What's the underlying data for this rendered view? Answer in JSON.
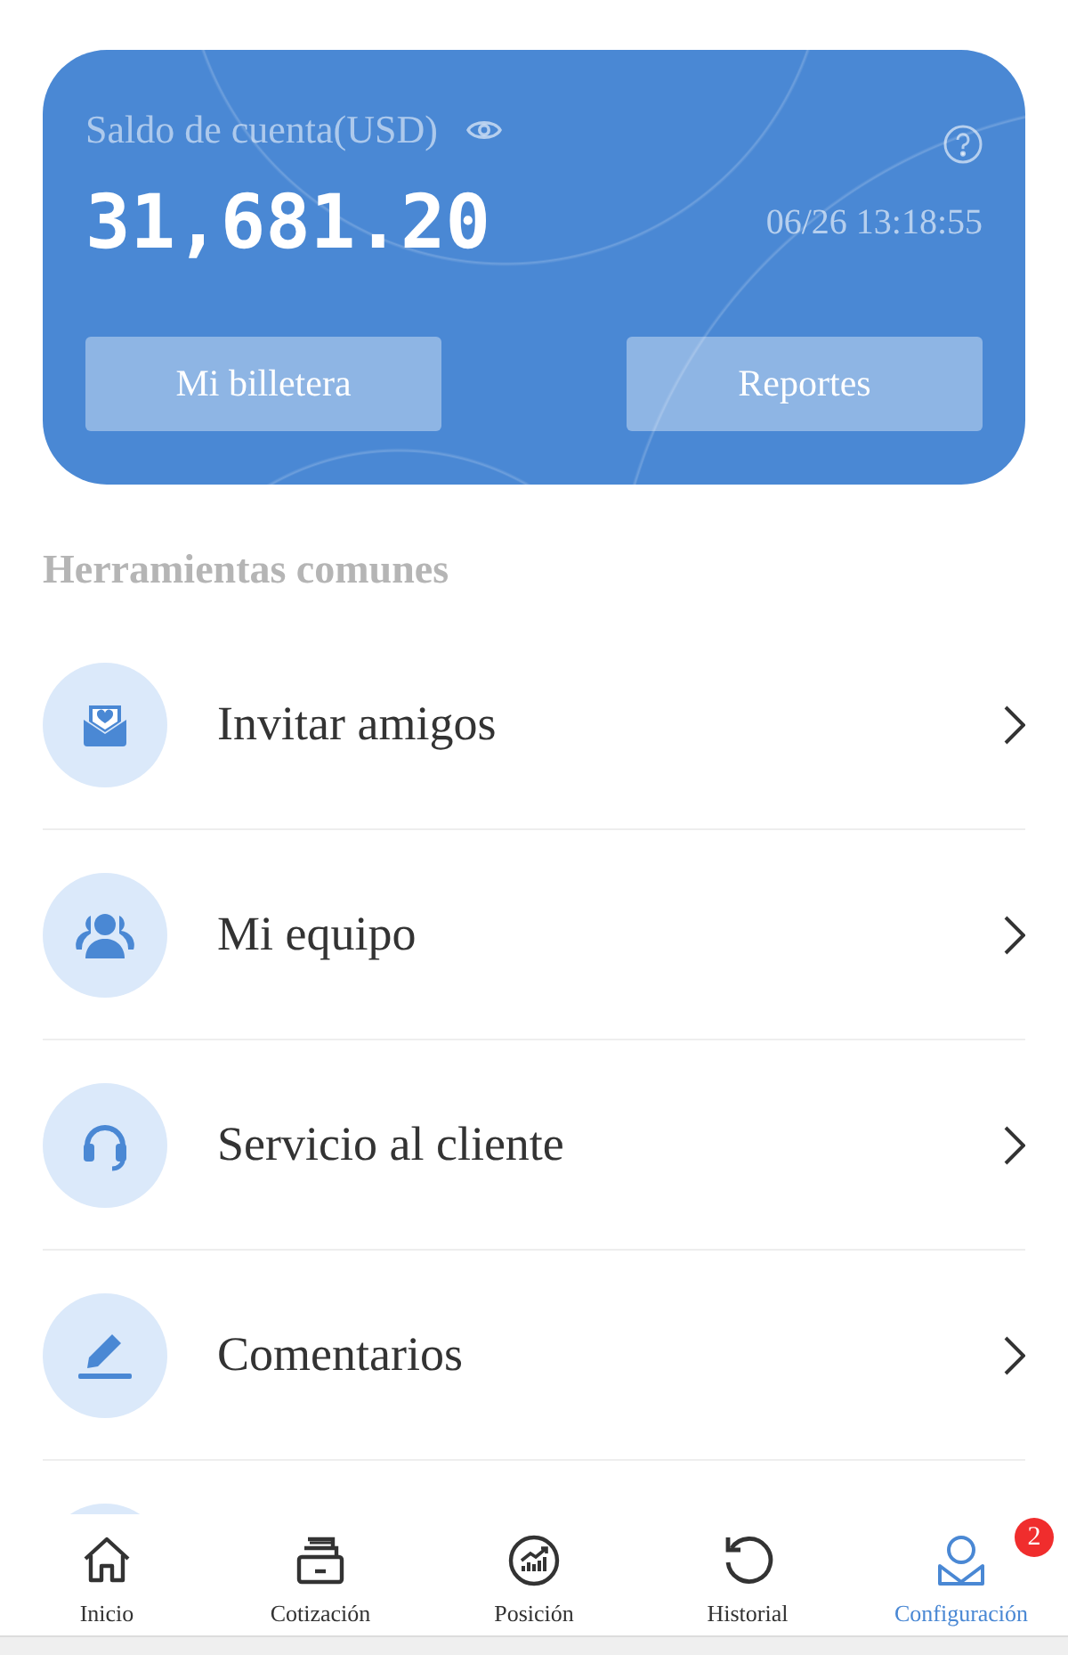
{
  "balance_card": {
    "label": "Saldo de cuenta(USD)",
    "amount": "31,681.20",
    "timestamp": "06/26 13:18:55",
    "buttons": [
      "Mi billetera",
      "Reportes"
    ]
  },
  "section_title": "Herramientas comunes",
  "tools": [
    {
      "label": "Invitar amigos",
      "kind": "invite"
    },
    {
      "label": "Mi equipo",
      "kind": "team"
    },
    {
      "label": "Servicio al cliente",
      "kind": "support"
    },
    {
      "label": "Comentarios",
      "kind": "feedback"
    },
    {
      "kind": "partial"
    }
  ],
  "tab_bar": [
    {
      "label": "Inicio",
      "kind": "home",
      "selected": false
    },
    {
      "label": "Cotización",
      "kind": "quote",
      "selected": false
    },
    {
      "label": "Posición",
      "kind": "position",
      "selected": false
    },
    {
      "label": "Historial",
      "kind": "history",
      "selected": false
    },
    {
      "label": "Configuración",
      "kind": "settings",
      "selected": true,
      "badge": "2"
    }
  ]
}
